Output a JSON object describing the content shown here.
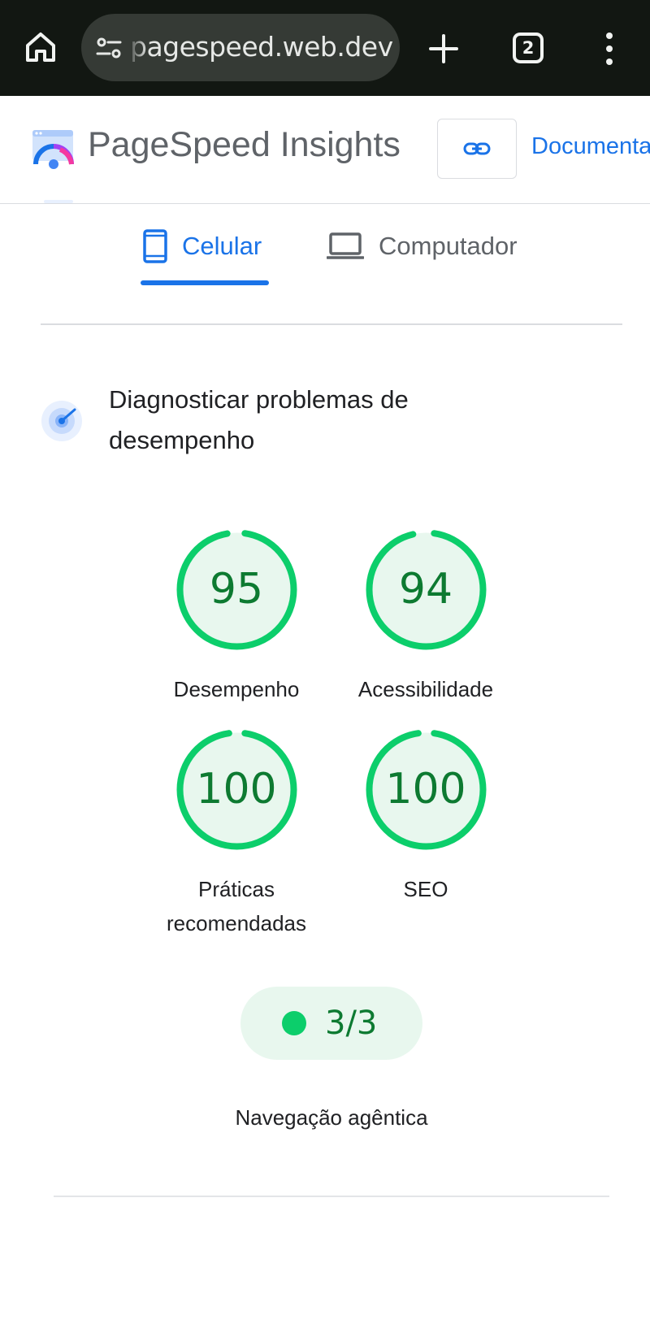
{
  "browser": {
    "url_text": "pagespeed.web.dev",
    "tab_count": "2"
  },
  "site": {
    "title": "PageSpeed Insights",
    "docs_link": "Documentação"
  },
  "device_tabs": [
    {
      "label": "Celular",
      "selected": true
    },
    {
      "label": "Computador",
      "selected": false
    }
  ],
  "diagnose": {
    "title": "Diagnosticar problemas de desempenho"
  },
  "scores": [
    {
      "value": "95",
      "label": "Desempenho",
      "fraction": 0.95
    },
    {
      "value": "94",
      "label": "Acessibilidade",
      "fraction": 0.94
    },
    {
      "value": "100",
      "label": "Práticas recomendadas",
      "fraction": 1.0
    },
    {
      "value": "100",
      "label": "SEO",
      "fraction": 1.0
    }
  ],
  "agentic": {
    "value": "3/3",
    "label": "Navegação agêntica"
  },
  "colors": {
    "score_good": "#0cce6b",
    "score_text": "#0d7a31",
    "score_fill": "#e8f7ee",
    "accent_blue": "#1a73e8",
    "chrome_bg": "#121712"
  }
}
